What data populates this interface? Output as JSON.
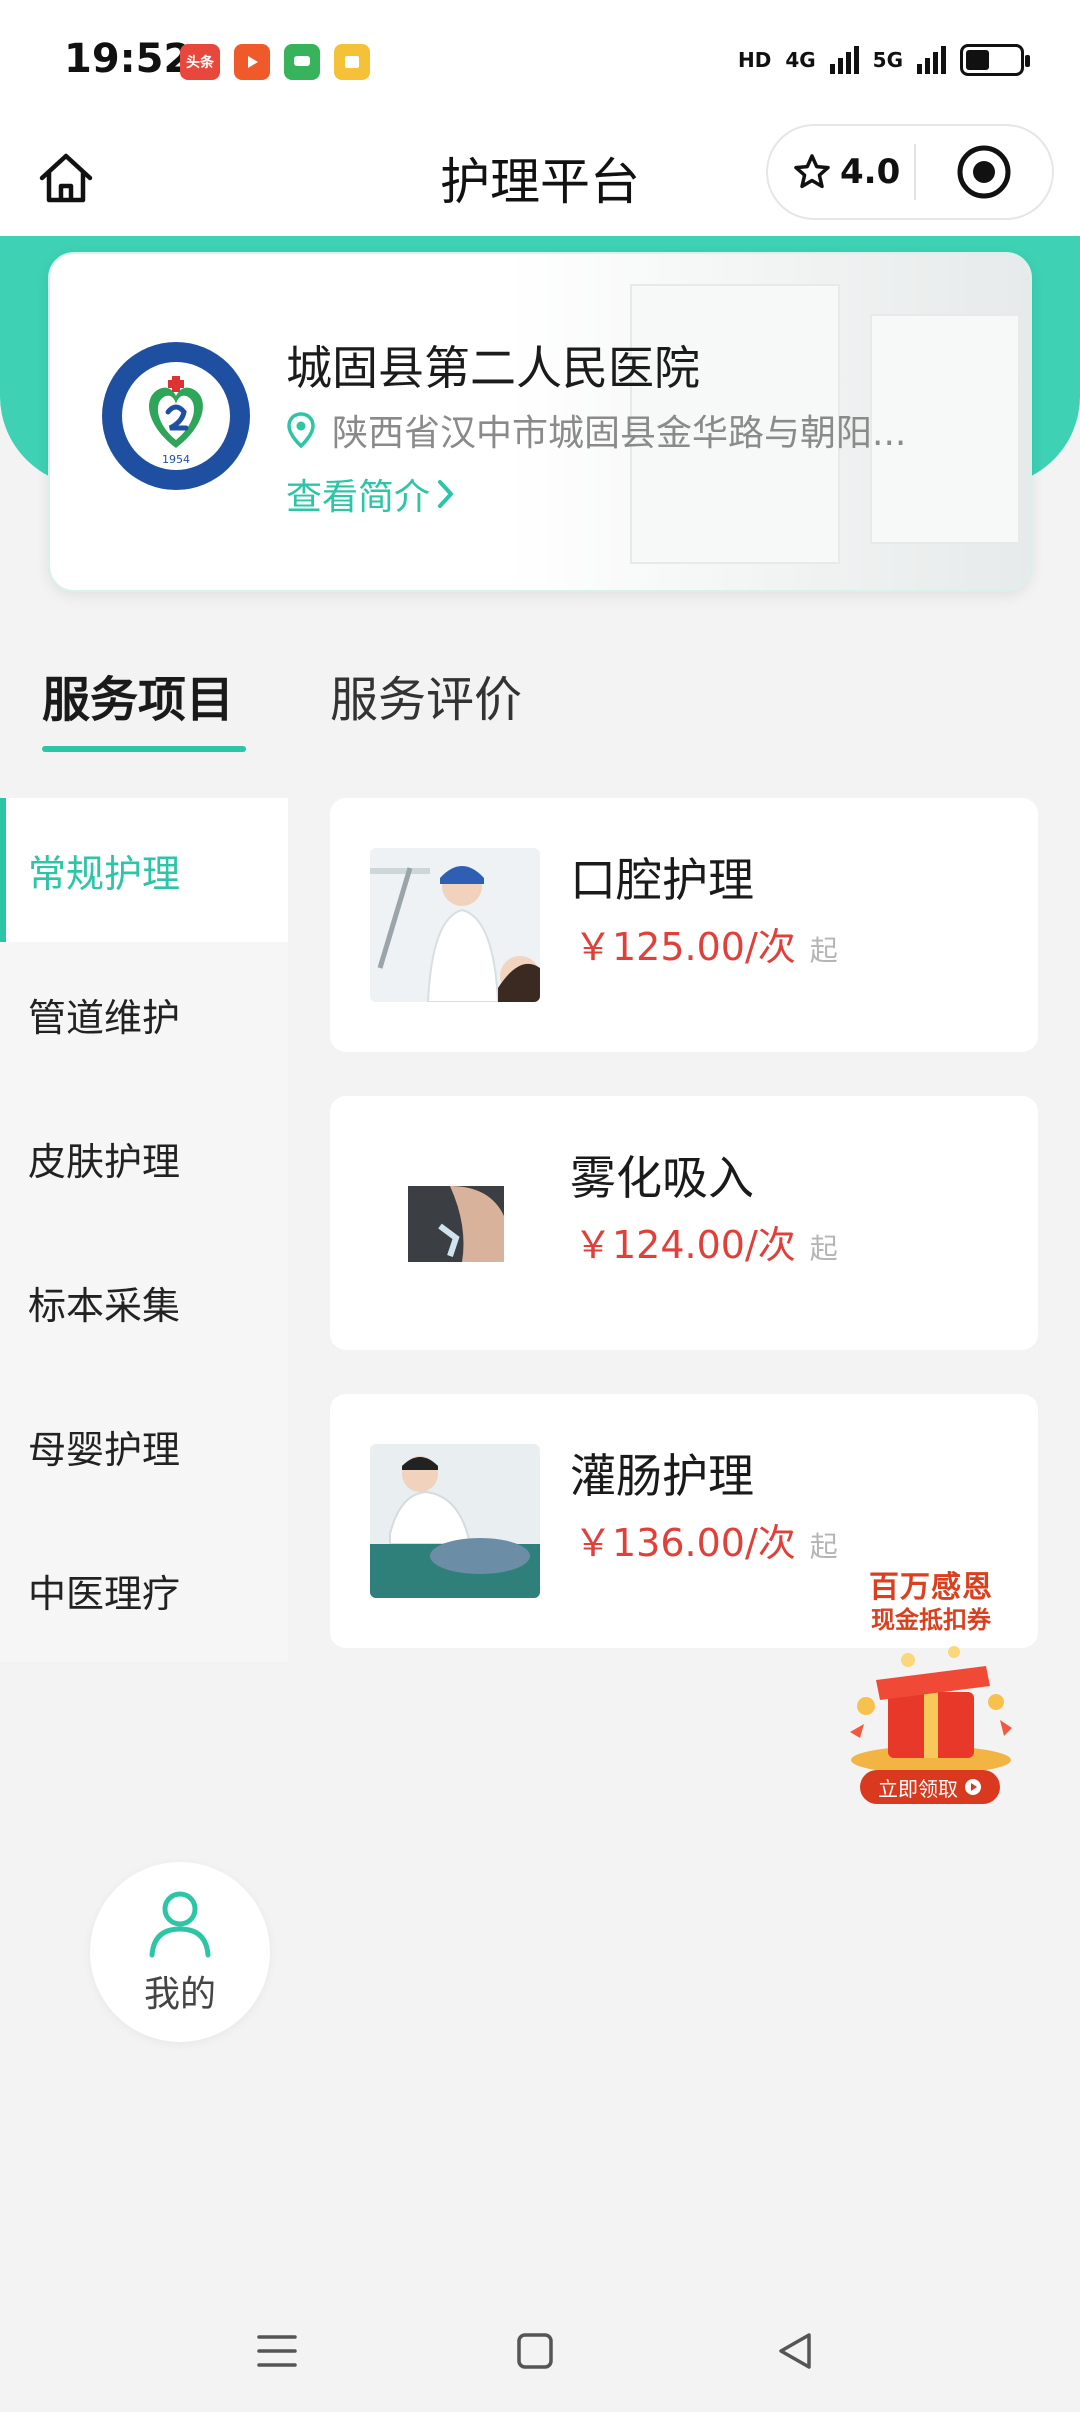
{
  "status_bar": {
    "time": "19:52",
    "apps": [
      "头条"
    ],
    "network_labels": [
      "HD",
      "4G",
      "5G"
    ]
  },
  "nav": {
    "title": "护理平台",
    "rating": "4.0"
  },
  "hospital": {
    "name": "城固县第二人民医院",
    "address": "陕西省汉中市城固县金华路与朝阳...",
    "intro_link": "查看简介",
    "logo_year": "1954"
  },
  "tabs": [
    {
      "label": "服务项目",
      "active": true
    },
    {
      "label": "服务评价",
      "active": false
    }
  ],
  "sidebar": {
    "items": [
      {
        "label": "常规护理",
        "active": true
      },
      {
        "label": "管道维护"
      },
      {
        "label": "皮肤护理"
      },
      {
        "label": "标本采集"
      },
      {
        "label": "母婴护理"
      },
      {
        "label": "中医理疗"
      }
    ]
  },
  "services": [
    {
      "name": "口腔护理",
      "price": "￥125.00/次",
      "suffix": "起"
    },
    {
      "name": "雾化吸入",
      "price": "￥124.00/次",
      "suffix": "起"
    },
    {
      "name": "灌肠护理",
      "price": "￥136.00/次",
      "suffix": "起"
    }
  ],
  "promo": {
    "title": "百万感恩",
    "subtitle": "现金抵扣券",
    "button": "立即领取"
  },
  "mine": {
    "label": "我的"
  },
  "colors": {
    "accent": "#2cc5a6",
    "header_teal": "#3ed1b4",
    "price_red": "#e0403a"
  }
}
